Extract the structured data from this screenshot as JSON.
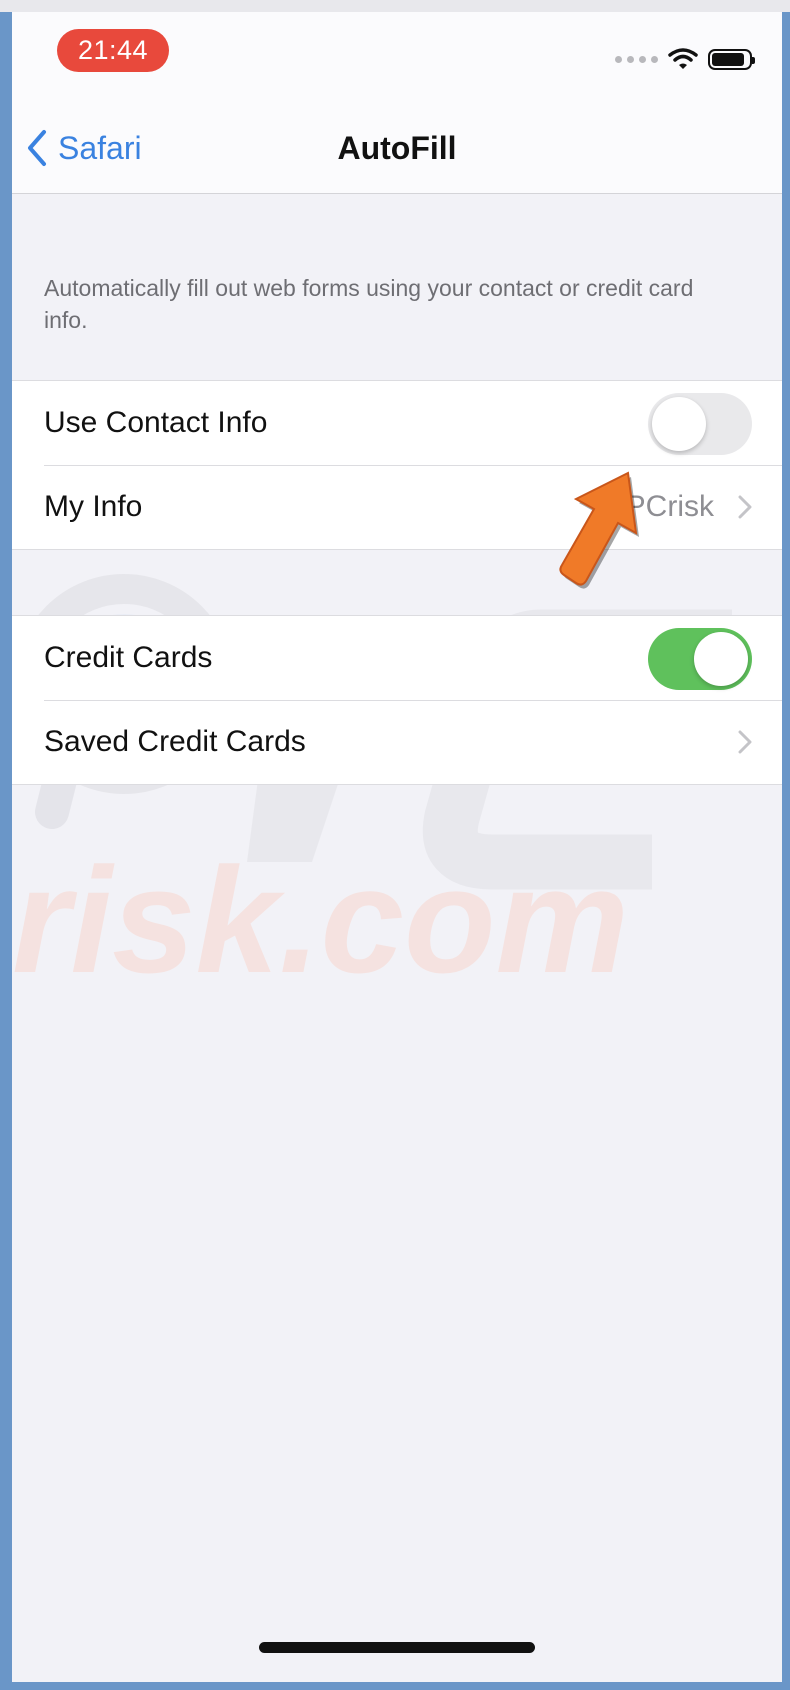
{
  "status_bar": {
    "time": "21:44"
  },
  "nav": {
    "back_label": "Safari",
    "title": "AutoFill"
  },
  "description": "Automatically fill out web forms using your contact or credit card info.",
  "contact_group": {
    "use_contact_info": {
      "label": "Use Contact Info",
      "enabled": false
    },
    "my_info": {
      "label": "My Info",
      "value": "PCrisk"
    }
  },
  "cards_group": {
    "credit_cards": {
      "label": "Credit Cards",
      "enabled": true
    },
    "saved_credit_cards": {
      "label": "Saved Credit Cards"
    }
  },
  "watermark": {
    "text": "risk.com"
  },
  "colors": {
    "accent": "#3a82e0",
    "toggle_on": "#5fc15c",
    "toggle_off": "#e9e9eb",
    "time_pill": "#e8493c",
    "annotation_arrow": "#f07a28"
  }
}
